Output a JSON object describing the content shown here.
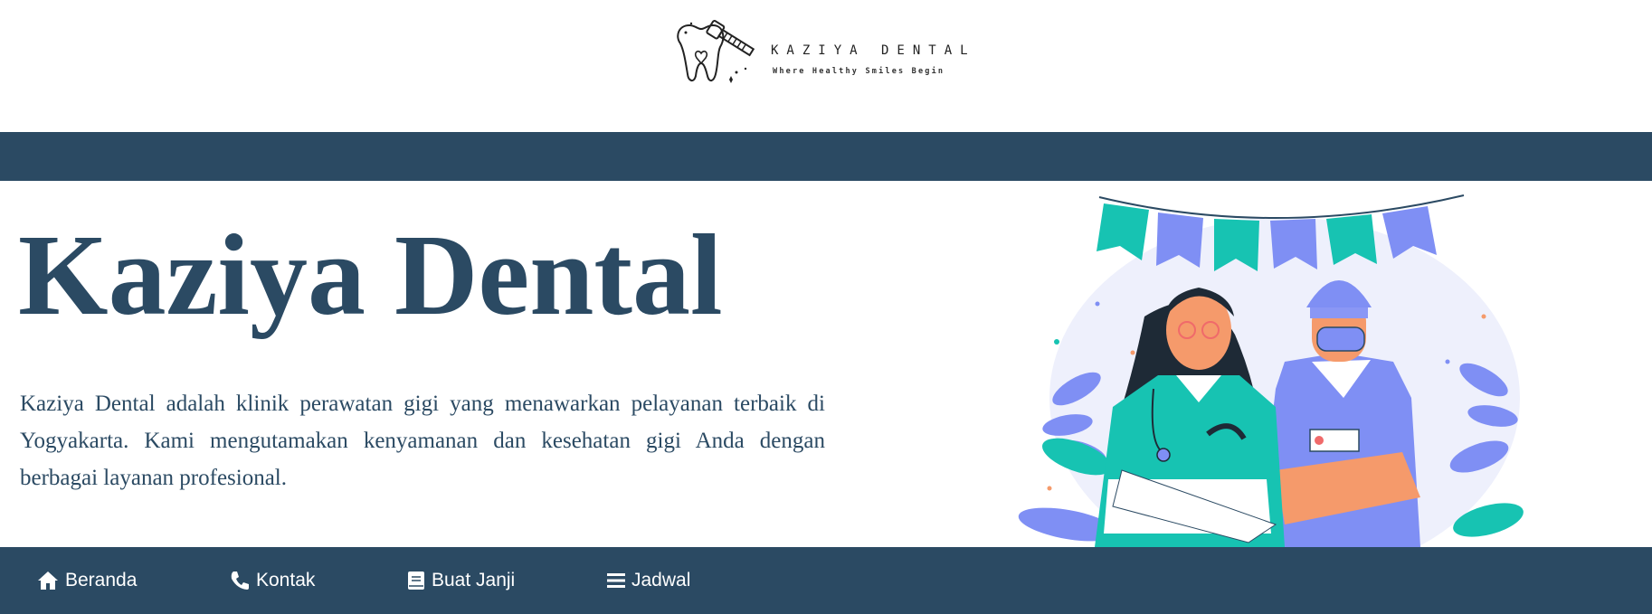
{
  "brand": {
    "logo_name": "KAZIYA DENTAL",
    "logo_tagline": "Where Healthy Smiles Begin"
  },
  "hero": {
    "title": "Kaziya Dental",
    "description": "Kaziya Dental adalah klinik perawatan gigi yang menawarkan pelayanan terbaik di Yogyakarta. Kami mengutamakan kenyamanan dan kesehatan gigi Anda dengan berbagai layanan profesional."
  },
  "nav": {
    "items": [
      {
        "label": "Beranda",
        "icon": "home-icon"
      },
      {
        "label": "Kontak",
        "icon": "phone-icon"
      },
      {
        "label": "Buat Janji",
        "icon": "book-icon"
      },
      {
        "label": "Jadwal",
        "icon": "menu-icon"
      }
    ]
  },
  "colors": {
    "primary": "#2b4a63",
    "teal": "#17c3b2",
    "periwinkle": "#7f8ff4",
    "skin": "#f59a6b"
  }
}
